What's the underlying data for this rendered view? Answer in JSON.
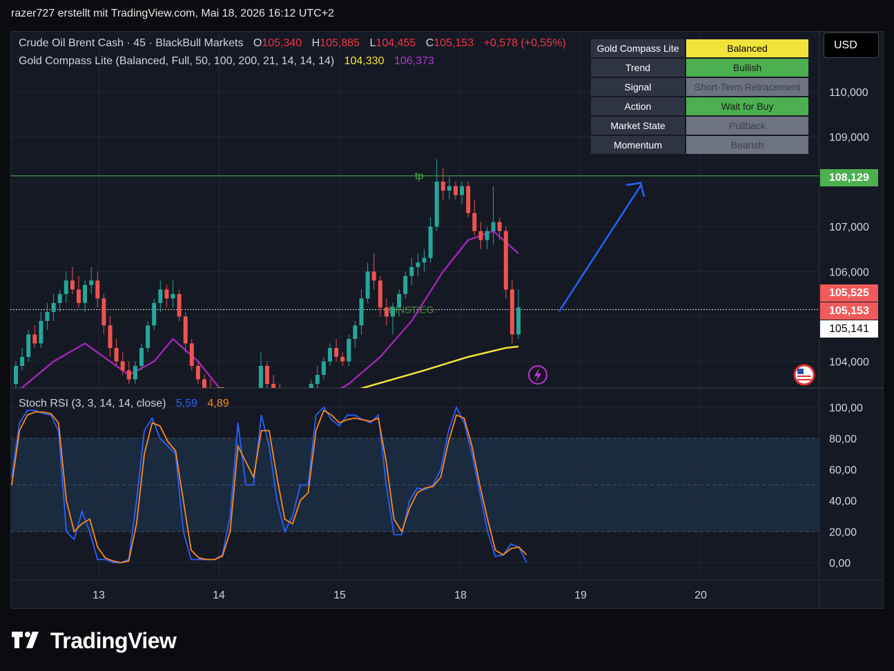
{
  "header": {
    "text": "razer727 erstellt mit TradingView.com, Mai 18, 2026 16:12 UTC+2"
  },
  "legend": {
    "symbol": "Crude Oil Brent Cash · 45 · BlackBull Markets",
    "ohlc": [
      "O",
      "105,340",
      "H",
      "105,885",
      "L",
      "104,455",
      "C",
      "105,153",
      "+0,578 (+0,55%)"
    ],
    "indicator": "Gold Compass Lite (Balanced, Full, 50, 100, 200, 21, 14, 14, 14)",
    "ind_val1": "104,330",
    "ind_val2": "106,373",
    "stoch": "Stoch RSI (3, 3, 14, 14, close)",
    "stoch_k": "5,59",
    "stoch_d": "4,89"
  },
  "currency_button": "USD",
  "dashboard": [
    {
      "key": "Gold Compass Lite",
      "value": "Balanced",
      "bg": "#f2e33c",
      "fg": "#000000"
    },
    {
      "key": "Trend",
      "value": "Bullish",
      "bg": "#4caf50",
      "fg": "#1a1a1a"
    },
    {
      "key": "Signal",
      "value": "Short-Term Retracement",
      "bg": "#6d7380",
      "fg": "#3a3f4a"
    },
    {
      "key": "Action",
      "value": "Wait for Buy",
      "bg": "#4caf50",
      "fg": "#1a1a1a"
    },
    {
      "key": "Market State",
      "value": "Pullback",
      "bg": "#6d7380",
      "fg": "#3a3f4a"
    },
    {
      "key": "Momentum",
      "value": "Bearish",
      "bg": "#6d7380",
      "fg": "#3a3f4a"
    }
  ],
  "price_tags": {
    "tp": "108,129",
    "bid": "105,525",
    "last": "105,153",
    "ask": "105,141"
  },
  "annotations": {
    "tp_label": "tp",
    "entry_label": "EINSTIEG"
  },
  "watermark": "TradingView",
  "colors": {
    "up": "#26a69a",
    "down": "#ef5350",
    "tp": "#4caf50",
    "ema_purple": "#9c27b0",
    "ema_yellow": "#f7e43a",
    "stoch_k": "#2962ff",
    "stoch_d": "#ff8a1a",
    "arrow": "#2962ff"
  },
  "chart_data": [
    {
      "type": "candlestick",
      "title": "Crude Oil Brent Cash · 45 · BlackBull Markets",
      "x_ticks": [
        "13",
        "14",
        "15",
        "18",
        "19",
        "20"
      ],
      "y_ticks": [
        "104,000",
        "105,000",
        "106,000",
        "107,000",
        "108,000",
        "109,000",
        "110,000"
      ],
      "y_range": [
        103.4,
        111.0
      ],
      "levels": {
        "tp": 108.129,
        "entry": 105.153
      },
      "candles": [
        [
          103.5,
          104.0,
          103.4,
          103.9
        ],
        [
          103.9,
          104.3,
          103.8,
          104.1
        ],
        [
          104.1,
          104.7,
          104.0,
          104.6
        ],
        [
          104.6,
          104.8,
          104.3,
          104.4
        ],
        [
          104.4,
          105.1,
          104.3,
          104.9
        ],
        [
          104.9,
          105.3,
          104.7,
          105.1
        ],
        [
          105.1,
          105.5,
          104.9,
          105.3
        ],
        [
          105.3,
          105.6,
          105.1,
          105.5
        ],
        [
          105.5,
          106.0,
          105.3,
          105.8
        ],
        [
          105.8,
          106.1,
          105.5,
          105.6
        ],
        [
          105.6,
          105.9,
          105.2,
          105.3
        ],
        [
          105.3,
          105.8,
          105.1,
          105.7
        ],
        [
          105.7,
          106.1,
          105.5,
          105.8
        ],
        [
          105.8,
          106.0,
          105.2,
          105.4
        ],
        [
          105.4,
          105.5,
          104.6,
          104.8
        ],
        [
          104.8,
          105.0,
          104.1,
          104.3
        ],
        [
          104.3,
          104.5,
          103.9,
          104.0
        ],
        [
          104.0,
          104.2,
          103.7,
          103.8
        ],
        [
          103.8,
          104.0,
          103.5,
          103.6
        ],
        [
          103.6,
          104.0,
          103.5,
          103.9
        ],
        [
          103.9,
          104.4,
          103.8,
          104.3
        ],
        [
          104.3,
          104.9,
          104.2,
          104.8
        ],
        [
          104.8,
          105.4,
          104.7,
          105.3
        ],
        [
          105.3,
          105.8,
          105.1,
          105.6
        ],
        [
          105.6,
          105.7,
          105.2,
          105.4
        ],
        [
          105.4,
          105.8,
          105.2,
          105.5
        ],
        [
          105.5,
          105.6,
          104.9,
          105.0
        ],
        [
          105.0,
          105.1,
          104.2,
          104.4
        ],
        [
          104.4,
          104.5,
          103.8,
          103.9
        ],
        [
          103.9,
          104.0,
          103.5,
          103.6
        ],
        [
          103.6,
          103.7,
          103.3,
          103.4
        ],
        [
          103.4,
          103.6,
          103.2,
          103.3
        ],
        [
          103.3,
          103.4,
          102.9,
          103.0
        ],
        [
          103.0,
          103.2,
          102.8,
          103.1
        ],
        [
          103.1,
          103.3,
          102.9,
          103.0
        ],
        [
          103.0,
          103.1,
          102.7,
          102.8
        ],
        [
          102.8,
          103.0,
          102.6,
          102.9
        ],
        [
          102.9,
          103.1,
          102.7,
          102.8
        ],
        [
          102.8,
          103.3,
          102.7,
          103.2
        ],
        [
          103.2,
          104.2,
          103.1,
          103.9
        ],
        [
          103.9,
          104.0,
          103.4,
          103.5
        ],
        [
          103.5,
          103.7,
          103.2,
          103.3
        ],
        [
          103.3,
          103.5,
          103.0,
          103.2
        ],
        [
          103.2,
          103.4,
          102.9,
          103.1
        ],
        [
          103.1,
          103.3,
          102.8,
          103.0
        ],
        [
          103.0,
          103.2,
          102.8,
          103.1
        ],
        [
          103.1,
          103.3,
          102.9,
          103.2
        ],
        [
          103.2,
          103.6,
          103.1,
          103.5
        ],
        [
          103.5,
          103.9,
          103.3,
          103.7
        ],
        [
          103.7,
          104.1,
          103.6,
          104.0
        ],
        [
          104.0,
          104.4,
          103.9,
          104.3
        ],
        [
          104.3,
          104.5,
          104.0,
          104.1
        ],
        [
          104.1,
          104.2,
          103.9,
          104.0
        ],
        [
          104.0,
          104.6,
          103.9,
          104.5
        ],
        [
          104.5,
          104.9,
          104.3,
          104.8
        ],
        [
          104.8,
          105.6,
          104.6,
          105.4
        ],
        [
          105.4,
          106.2,
          105.3,
          106.0
        ],
        [
          106.0,
          106.4,
          105.6,
          105.8
        ],
        [
          105.8,
          105.9,
          105.0,
          105.2
        ],
        [
          105.2,
          105.4,
          104.8,
          105.0
        ],
        [
          105.0,
          105.3,
          104.6,
          105.2
        ],
        [
          105.2,
          105.6,
          105.0,
          105.5
        ],
        [
          105.5,
          106.0,
          105.4,
          105.9
        ],
        [
          105.9,
          106.3,
          105.7,
          106.1
        ],
        [
          106.1,
          106.4,
          105.9,
          106.2
        ],
        [
          106.2,
          106.5,
          106.0,
          106.3
        ],
        [
          106.3,
          107.2,
          106.2,
          107.0
        ],
        [
          107.0,
          108.5,
          106.9,
          108.0
        ],
        [
          108.0,
          108.3,
          107.6,
          107.8
        ],
        [
          107.8,
          108.1,
          107.6,
          107.9
        ],
        [
          107.9,
          108.0,
          107.6,
          107.7
        ],
        [
          107.7,
          108.0,
          107.5,
          107.9
        ],
        [
          107.9,
          108.0,
          107.2,
          107.3
        ],
        [
          107.3,
          107.6,
          106.8,
          106.9
        ],
        [
          106.9,
          107.1,
          106.5,
          106.7
        ],
        [
          106.7,
          107.0,
          106.5,
          106.9
        ],
        [
          106.9,
          107.9,
          106.6,
          107.1
        ],
        [
          107.1,
          107.2,
          106.7,
          106.9
        ],
        [
          106.9,
          107.0,
          105.4,
          105.6
        ],
        [
          105.6,
          105.8,
          104.4,
          104.6
        ],
        [
          104.6,
          105.6,
          104.5,
          105.2
        ]
      ],
      "ema_purple": [
        [
          0,
          103.3
        ],
        [
          6,
          104.0
        ],
        [
          11,
          104.4
        ],
        [
          15,
          104.0
        ],
        [
          18,
          103.7
        ],
        [
          22,
          104.0
        ],
        [
          25,
          104.5
        ],
        [
          29,
          104.0
        ],
        [
          33,
          103.3
        ],
        [
          38,
          103.0
        ],
        [
          44,
          102.7
        ],
        [
          48,
          103.1
        ],
        [
          53,
          103.5
        ],
        [
          58,
          104.1
        ],
        [
          63,
          104.9
        ],
        [
          68,
          106.0
        ],
        [
          72,
          106.7
        ],
        [
          76,
          106.9
        ],
        [
          80,
          106.4
        ]
      ],
      "ema_yellow": [
        [
          22,
          103.3
        ],
        [
          33,
          103.4
        ],
        [
          44,
          102.5
        ],
        [
          55,
          103.4
        ],
        [
          65,
          103.8
        ],
        [
          72,
          104.1
        ],
        [
          78,
          104.3
        ],
        [
          80,
          104.33
        ]
      ]
    },
    {
      "type": "line",
      "title": "Stoch RSI (3, 3, 14, 14, close)",
      "y_ticks": [
        "0,00",
        "20,00",
        "40,00",
        "60,00",
        "80,00",
        "100,00"
      ],
      "y_range": [
        0,
        100
      ],
      "bands": [
        20,
        50,
        80
      ],
      "series": [
        {
          "name": "5,59",
          "values": [
            55,
            90,
            98,
            98,
            96,
            95,
            85,
            20,
            15,
            33,
            20,
            2,
            2,
            0,
            0,
            2,
            40,
            85,
            93,
            80,
            75,
            70,
            20,
            2,
            2,
            2,
            2,
            5,
            30,
            90,
            50,
            50,
            95,
            75,
            40,
            20,
            30,
            50,
            50,
            95,
            100,
            92,
            88,
            95,
            95,
            92,
            90,
            95,
            50,
            18,
            18,
            40,
            48,
            47,
            50,
            60,
            85,
            100,
            90,
            70,
            45,
            20,
            4,
            5,
            12,
            10,
            0
          ]
        },
        {
          "name": "4,89",
          "values": [
            50,
            85,
            95,
            97,
            97,
            96,
            90,
            40,
            20,
            25,
            28,
            10,
            3,
            1,
            0,
            1,
            25,
            70,
            90,
            88,
            78,
            72,
            40,
            8,
            3,
            2,
            2,
            4,
            20,
            75,
            65,
            55,
            85,
            85,
            55,
            28,
            25,
            40,
            45,
            85,
            98,
            95,
            90,
            92,
            93,
            92,
            91,
            93,
            65,
            28,
            20,
            35,
            45,
            48,
            49,
            55,
            78,
            95,
            93,
            75,
            50,
            28,
            8,
            5,
            9,
            10,
            5
          ]
        }
      ]
    }
  ]
}
